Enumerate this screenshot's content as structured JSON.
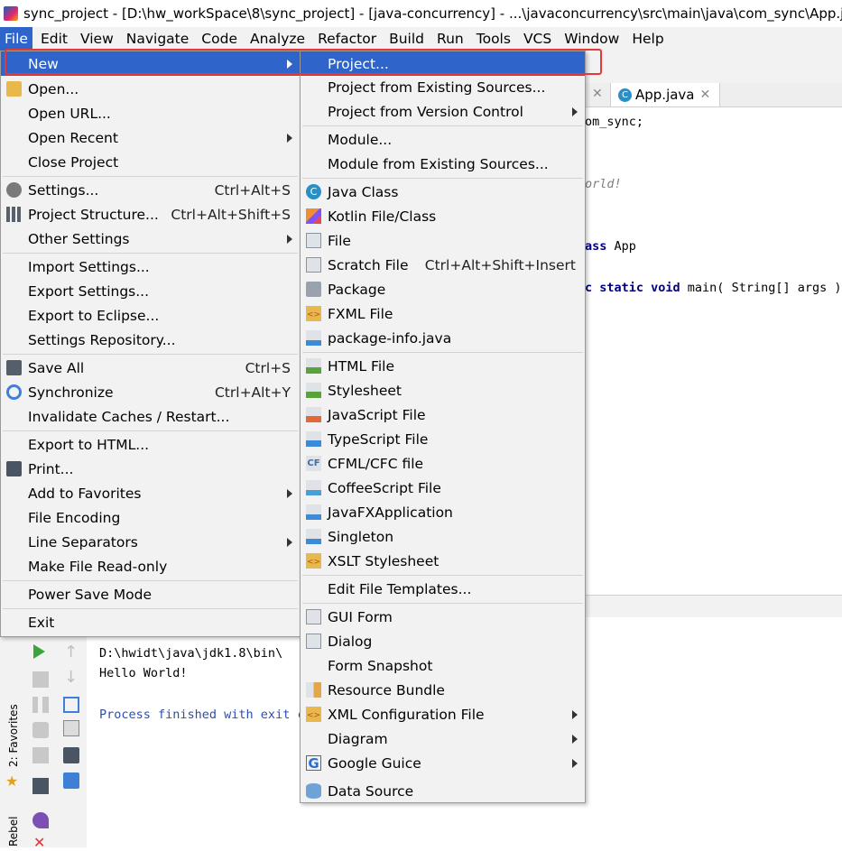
{
  "window": {
    "title": "sync_project - [D:\\hw_workSpace\\8\\sync_project] - [java-concurrency] - ...\\javaconcurrency\\src\\main\\java\\com_sync\\App.java"
  },
  "menubar": [
    "File",
    "Edit",
    "View",
    "Navigate",
    "Code",
    "Analyze",
    "Refactor",
    "Build",
    "Run",
    "Tools",
    "VCS",
    "Window",
    "Help"
  ],
  "editor": {
    "tab_label": "App.java",
    "code": {
      "line1": "om_sync;",
      "line2": "orld!",
      "line3_kw": "ass",
      "line3": " App",
      "line4_kw": "c static void",
      "line4": " main( String[] args )"
    }
  },
  "console": {
    "line1": "D:\\hwidt\\java\\jdk1.8\\bin\\",
    "line2": "Hello World!",
    "line3": "Process finished with exit c"
  },
  "side_tools": {
    "favorites": "2: Favorites",
    "rebel": "Rebel"
  },
  "file_menu": {
    "items": [
      {
        "label": "New",
        "shortcut": "",
        "submenu": true,
        "selected": true
      },
      {
        "label": "Open...",
        "shortcut": "",
        "icon": "folder-icon"
      },
      {
        "label": "Open URL...",
        "shortcut": ""
      },
      {
        "label": "Open Recent",
        "shortcut": "",
        "submenu": true
      },
      {
        "label": "Close Project",
        "shortcut": ""
      },
      {
        "label": "Settings...",
        "shortcut": "Ctrl+Alt+S",
        "icon": "wrench-icon"
      },
      {
        "label": "Project Structure...",
        "shortcut": "Ctrl+Alt+Shift+S",
        "icon": "project-structure-icon"
      },
      {
        "label": "Other Settings",
        "shortcut": "",
        "submenu": true
      },
      {
        "label": "Import Settings...",
        "shortcut": ""
      },
      {
        "label": "Export Settings...",
        "shortcut": ""
      },
      {
        "label": "Export to Eclipse...",
        "shortcut": ""
      },
      {
        "label": "Settings Repository...",
        "shortcut": ""
      },
      {
        "label": "Save All",
        "shortcut": "Ctrl+S",
        "icon": "save-icon"
      },
      {
        "label": "Synchronize",
        "shortcut": "Ctrl+Alt+Y",
        "icon": "sync-icon"
      },
      {
        "label": "Invalidate Caches / Restart...",
        "shortcut": ""
      },
      {
        "label": "Export to HTML...",
        "shortcut": ""
      },
      {
        "label": "Print...",
        "shortcut": "",
        "icon": "print-icon"
      },
      {
        "label": "Add to Favorites",
        "shortcut": "",
        "submenu": true
      },
      {
        "label": "File Encoding",
        "shortcut": ""
      },
      {
        "label": "Line Separators",
        "shortcut": "",
        "submenu": true
      },
      {
        "label": "Make File Read-only",
        "shortcut": ""
      },
      {
        "label": "Power Save Mode",
        "shortcut": ""
      },
      {
        "label": "Exit",
        "shortcut": ""
      }
    ]
  },
  "new_menu": {
    "items": [
      {
        "label": "Project...",
        "selected": true
      },
      {
        "label": "Project from Existing Sources..."
      },
      {
        "label": "Project from Version Control",
        "submenu": true
      },
      {
        "label": "Module..."
      },
      {
        "label": "Module from Existing Sources..."
      },
      {
        "label": "Java Class",
        "icon": "java-class-icon"
      },
      {
        "label": "Kotlin File/Class",
        "icon": "kotlin-icon"
      },
      {
        "label": "File",
        "icon": "file-icon"
      },
      {
        "label": "Scratch File",
        "shortcut": "Ctrl+Alt+Shift+Insert",
        "icon": "scratch-file-icon"
      },
      {
        "label": "Package",
        "icon": "package-icon"
      },
      {
        "label": "FXML File",
        "icon": "fxml-icon"
      },
      {
        "label": "package-info.java",
        "icon": "java-file-icon"
      },
      {
        "label": "HTML File",
        "icon": "html-icon"
      },
      {
        "label": "Stylesheet",
        "icon": "css-icon"
      },
      {
        "label": "JavaScript File",
        "icon": "javascript-icon"
      },
      {
        "label": "TypeScript File",
        "icon": "typescript-icon"
      },
      {
        "label": "CFML/CFC file",
        "icon": "cfml-icon"
      },
      {
        "label": "CoffeeScript File",
        "icon": "coffeescript-icon"
      },
      {
        "label": "JavaFXApplication",
        "icon": "javafx-icon"
      },
      {
        "label": "Singleton",
        "icon": "singleton-icon"
      },
      {
        "label": "XSLT Stylesheet",
        "icon": "xslt-icon"
      },
      {
        "label": "Edit File Templates..."
      },
      {
        "label": "GUI Form",
        "icon": "gui-form-icon"
      },
      {
        "label": "Dialog",
        "icon": "dialog-icon"
      },
      {
        "label": "Form Snapshot"
      },
      {
        "label": "Resource Bundle",
        "icon": "resource-bundle-icon"
      },
      {
        "label": "XML Configuration File",
        "submenu": true,
        "icon": "xml-config-icon"
      },
      {
        "label": "Diagram",
        "submenu": true
      },
      {
        "label": "Google Guice",
        "submenu": true,
        "icon": "google-icon"
      },
      {
        "label": "Data Source",
        "icon": "database-icon"
      }
    ]
  },
  "badges": {
    "css": "CSS",
    "js": "JS",
    "ts": "TS",
    "h": "H",
    "cf": "CF",
    "c": "C",
    "fx": "<>",
    "j": "J"
  },
  "colors": {
    "selection": "#2f65ca",
    "highlight_box": "#e53935",
    "menu_bg": "#f2f2f2"
  }
}
